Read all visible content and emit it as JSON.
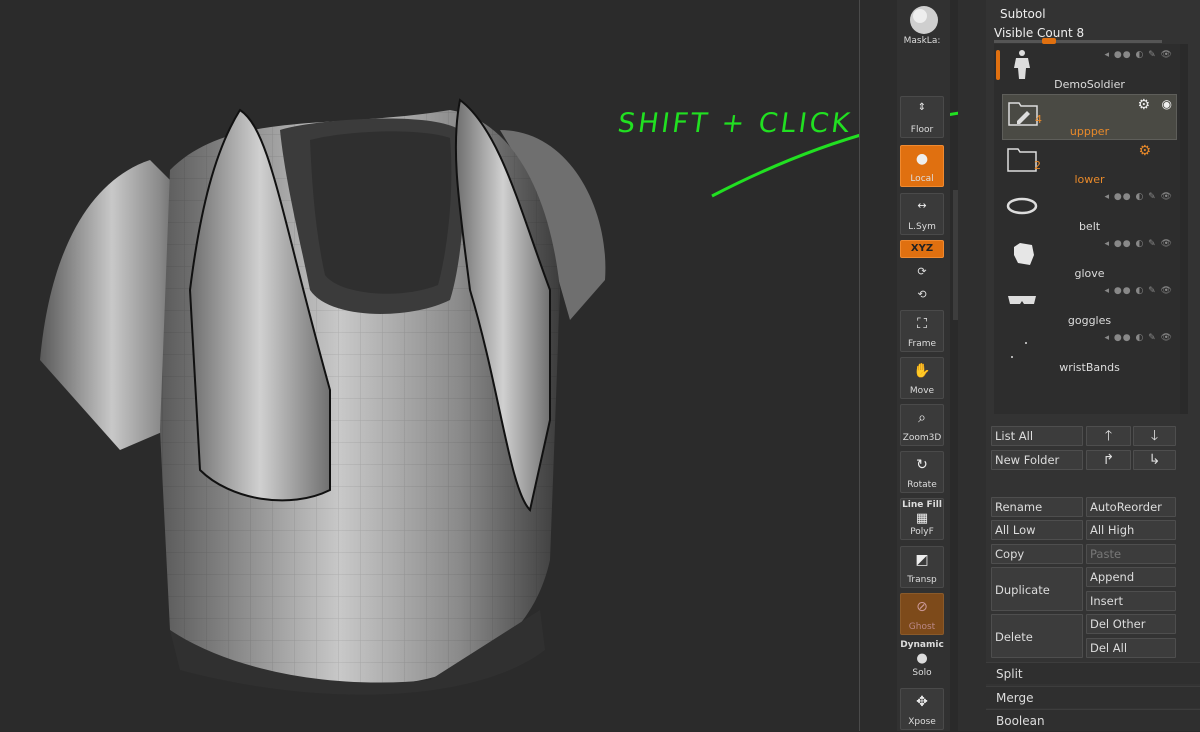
{
  "annotation": {
    "text": "SHIFT + CLICK",
    "color": "#21e021"
  },
  "shelf": {
    "masklasso_label": "MaskLa:",
    "floor_label": "Floor",
    "local_label": "Local",
    "lsym_label": "L.Sym",
    "xyz_label": "XYZ",
    "frame_label": "Frame",
    "move_label": "Move",
    "zoom3d_label": "Zoom3D",
    "rotate_label": "Rotate",
    "linefill_label": "Line Fill",
    "polyf_label": "PolyF",
    "transp_label": "Transp",
    "ghost_label": "Ghost",
    "dynamic_label": "Dynamic",
    "solo_label": "Solo",
    "xpose_label": "Xpose"
  },
  "subtool": {
    "title": "Subtool",
    "visible_count_label": "Visible Count",
    "visible_count": "8",
    "items": [
      {
        "name": "DemoSoldier",
        "icon": "soldier-figure-icon"
      },
      {
        "name": "uppper",
        "count": "4",
        "icon": "folder-edit-icon",
        "selected": true
      },
      {
        "name": "lower",
        "count": "2",
        "icon": "folder-icon"
      },
      {
        "name": "belt",
        "icon": "belt-icon"
      },
      {
        "name": "glove",
        "icon": "glove-icon"
      },
      {
        "name": "goggles",
        "icon": "goggles-icon"
      },
      {
        "name": "wristBands",
        "icon": "wristbands-icon"
      }
    ],
    "buttons": {
      "list_all": "List All",
      "new_folder": "New Folder",
      "rename": "Rename",
      "auto_reorder": "AutoReorder",
      "all_low": "All Low",
      "all_high": "All High",
      "copy": "Copy",
      "paste": "Paste",
      "duplicate": "Duplicate",
      "append": "Append",
      "insert": "Insert",
      "delete": "Delete",
      "del_other": "Del Other",
      "del_all": "Del All"
    },
    "sections": {
      "split": "Split",
      "merge": "Merge",
      "boolean": "Boolean"
    }
  },
  "colors": {
    "accent": "#e07010",
    "folder_label": "#e98a2a"
  }
}
